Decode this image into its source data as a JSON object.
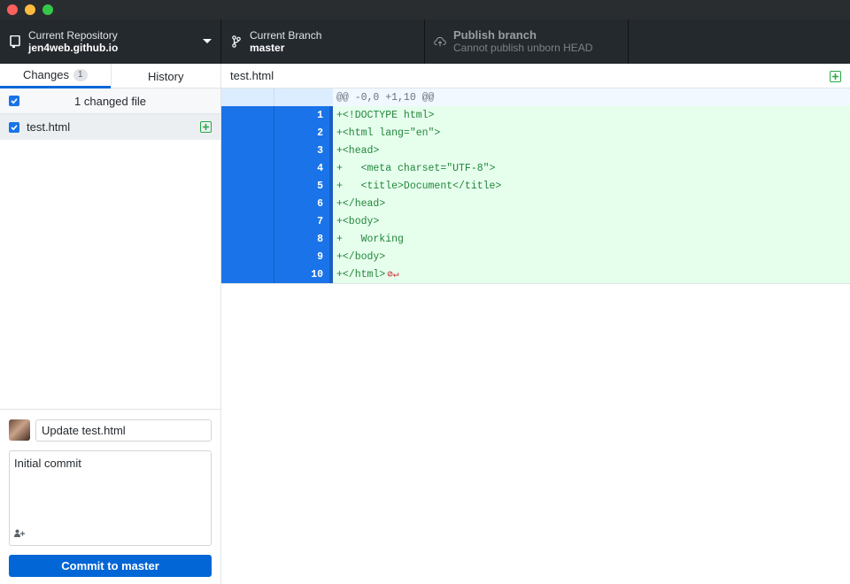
{
  "toolbar": {
    "repo_label": "Current Repository",
    "repo_value": "jen4web.github.io",
    "branch_label": "Current Branch",
    "branch_value": "master",
    "publish_label": "Publish branch",
    "publish_sub": "Cannot publish unborn HEAD"
  },
  "tabs": {
    "changes_label": "Changes",
    "changes_count": "1",
    "history_label": "History"
  },
  "changes": {
    "summary": "1 changed file",
    "files": [
      {
        "name": "test.html",
        "status": "added"
      }
    ]
  },
  "commit": {
    "summary_value": "Update test.html",
    "description": "Initial commit",
    "button_label": "Commit to master"
  },
  "diff": {
    "file_name": "test.html",
    "hunk_header": "@@ -0,0 +1,10 @@",
    "lines": [
      {
        "num": "1",
        "text": "+<!DOCTYPE html>"
      },
      {
        "num": "2",
        "text": "+<html lang=\"en\">"
      },
      {
        "num": "3",
        "text": "+<head>"
      },
      {
        "num": "4",
        "text": "+   <meta charset=\"UTF-8\">"
      },
      {
        "num": "5",
        "text": "+   <title>Document</title>"
      },
      {
        "num": "6",
        "text": "+</head>"
      },
      {
        "num": "7",
        "text": "+<body>"
      },
      {
        "num": "8",
        "text": "+   Working"
      },
      {
        "num": "9",
        "text": "+</body>"
      },
      {
        "num": "10",
        "text": "+</html>"
      }
    ],
    "no_eol_marker": "⊘↵"
  },
  "colors": {
    "accent": "#0366d6",
    "added_bg": "#e6ffed",
    "added_text": "#22863a",
    "gutter_selected": "#1a73e8"
  }
}
